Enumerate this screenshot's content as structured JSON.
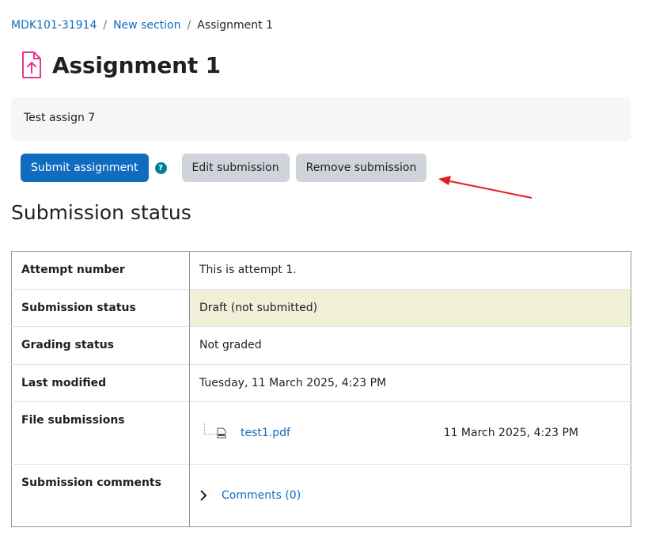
{
  "breadcrumb": {
    "course": "MDK101-31914",
    "section": "New section",
    "current": "Assignment 1"
  },
  "page": {
    "title": "Assignment 1",
    "intro": "Test assign 7"
  },
  "actions": {
    "submit": "Submit assignment",
    "help_glyph": "?",
    "edit": "Edit submission",
    "remove": "Remove submission"
  },
  "section_heading": "Submission status",
  "status_table": {
    "attempt_label": "Attempt number",
    "attempt_value": "This is attempt 1.",
    "status_label": "Submission status",
    "status_value": "Draft (not submitted)",
    "grading_label": "Grading status",
    "grading_value": "Not graded",
    "modified_label": "Last modified",
    "modified_value": "Tuesday, 11 March 2025, 4:23 PM",
    "files_label": "File submissions",
    "file_name": "test1.pdf",
    "file_date": "11 March 2025, 4:23 PM",
    "comments_label": "Submission comments",
    "comments_link": "Comments (0)"
  },
  "colors": {
    "primary": "#0f6cbf",
    "secondary_button": "#ced4da",
    "activity_icon": "#e8358f",
    "draft_highlight": "#f0f0d8",
    "help_icon": "#008196",
    "annotation_arrow": "#e01e1e"
  },
  "icons": {
    "activity": "assignment-upload-icon",
    "help": "help-icon",
    "file": "pdf-file-icon",
    "expand": "chevron-right-icon",
    "annotation": "red-arrow"
  }
}
